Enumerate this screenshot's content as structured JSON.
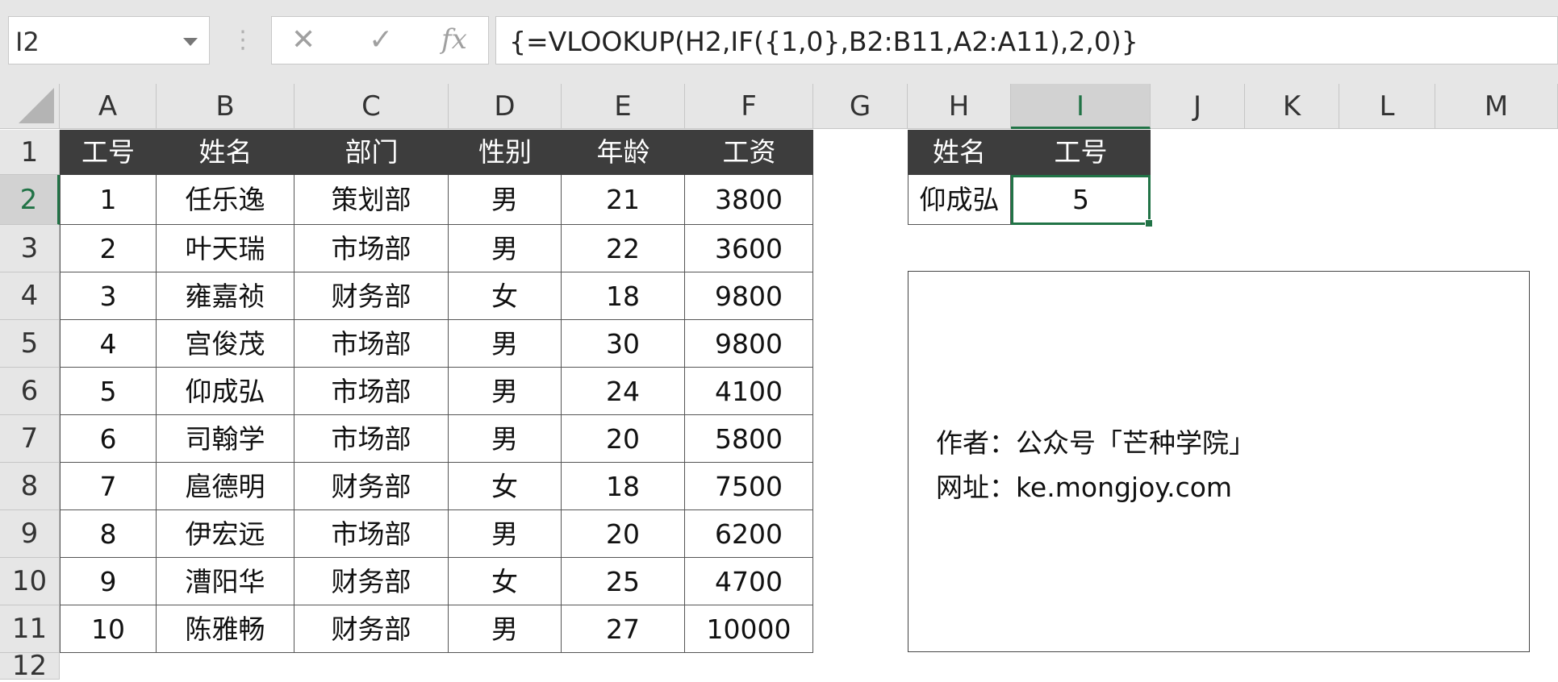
{
  "formula_bar": {
    "name_box": "I2",
    "dots": "⋮",
    "cancel_glyph": "✕",
    "enter_glyph": "✓",
    "fx_glyph": "fx",
    "formula": "{=VLOOKUP(H2,IF({1,0},B2:B11,A2:A11),2,0)}"
  },
  "columns": [
    "A",
    "B",
    "C",
    "D",
    "E",
    "F",
    "G",
    "H",
    "I",
    "J",
    "K",
    "L",
    "M"
  ],
  "rows": [
    "1",
    "2",
    "3",
    "4",
    "5",
    "6",
    "7",
    "8",
    "9",
    "10",
    "11",
    "12"
  ],
  "table": {
    "headers": [
      "工号",
      "姓名",
      "部门",
      "性别",
      "年龄",
      "工资"
    ],
    "rows": [
      [
        "1",
        "任乐逸",
        "策划部",
        "男",
        "21",
        "3800"
      ],
      [
        "2",
        "叶天瑞",
        "市场部",
        "男",
        "22",
        "3600"
      ],
      [
        "3",
        "雍嘉祯",
        "财务部",
        "女",
        "18",
        "9800"
      ],
      [
        "4",
        "宫俊茂",
        "市场部",
        "男",
        "30",
        "9800"
      ],
      [
        "5",
        "仰成弘",
        "市场部",
        "男",
        "24",
        "4100"
      ],
      [
        "6",
        "司翰学",
        "市场部",
        "男",
        "20",
        "5800"
      ],
      [
        "7",
        "扈德明",
        "财务部",
        "女",
        "18",
        "7500"
      ],
      [
        "8",
        "伊宏远",
        "市场部",
        "男",
        "20",
        "6200"
      ],
      [
        "9",
        "漕阳华",
        "财务部",
        "女",
        "25",
        "4700"
      ],
      [
        "10",
        "陈雅畅",
        "财务部",
        "男",
        "27",
        "10000"
      ]
    ]
  },
  "lookup": {
    "headers": [
      "姓名",
      "工号"
    ],
    "name": "仰成弘",
    "result": "5"
  },
  "note": {
    "line1": "作者：公众号「芒种学院」",
    "line2": "网址：ke.mongjoy.com"
  },
  "colors": {
    "accent": "#217346",
    "header_fill": "#3d3d3d"
  }
}
